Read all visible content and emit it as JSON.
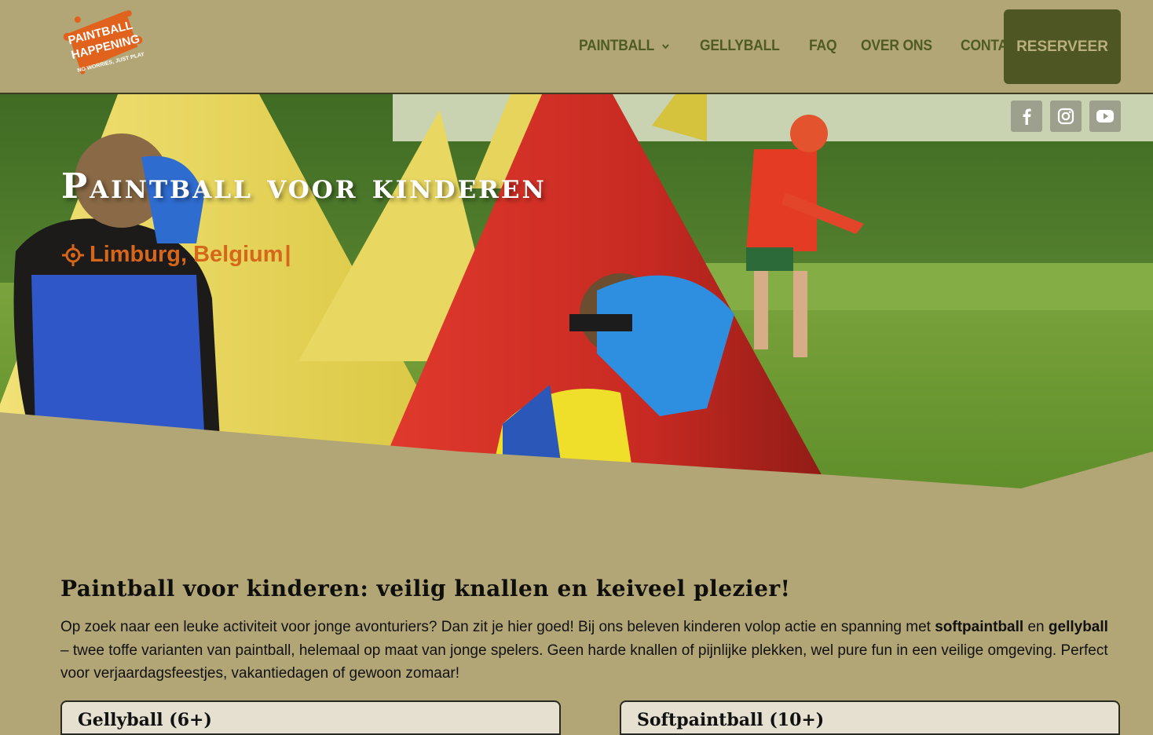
{
  "logo": {
    "line1": "PAINTBALL",
    "line2": "HAPPENING",
    "tagline": "NO WORRIES, JUST PLAY"
  },
  "nav": {
    "items": [
      "PAINTBALL",
      "GELLYBALL",
      "FAQ",
      "OVER ONS",
      "CONTACT"
    ],
    "reserve_label": "RESERVEER"
  },
  "social": [
    "facebook-icon",
    "instagram-icon",
    "youtube-icon"
  ],
  "hero": {
    "title": "Paintball voor kinderen",
    "location": "Limburg, Belgium",
    "cursor": "|"
  },
  "section": {
    "title": "Paintball voor kinderen: veilig knallen en keiveel plezier!",
    "intro_part1": "Op zoek naar een leuke activiteit voor jonge avonturiers? Dan zit je hier goed! Bij ons beleven kinderen volop actie en spanning met ",
    "intro_bold1": "softpaintball",
    "intro_mid": " en ",
    "intro_bold2": "gellyball",
    "intro_part2": " – twee toffe varianten van paintball, helemaal op maat van jonge spelers. Geen harde knallen of pijnlijke plekken, wel pure fun in een veilige omgeving. Perfect voor verjaardagsfeestjes, vakantiedagen of gewoon zomaar!"
  },
  "cards": [
    {
      "title": "Gellyball (6+)"
    },
    {
      "title": "Softpaintball (10+)"
    }
  ],
  "colors": {
    "background": "#b3a676",
    "nav_text": "#4e5b23",
    "reserve_bg": "#4e5624",
    "accent_orange": "#d6661a"
  }
}
